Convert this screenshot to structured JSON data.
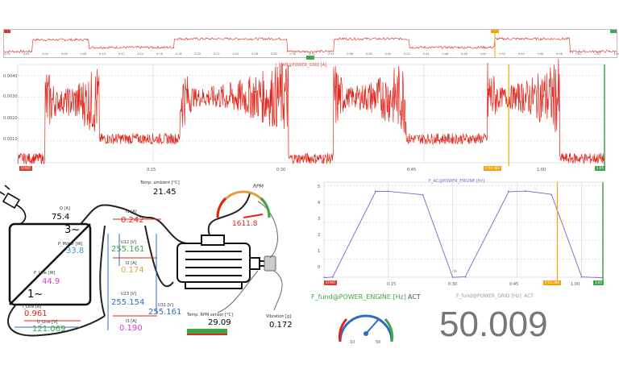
{
  "colors": {
    "signal": "#e0251b",
    "cursor": "#f5a20a",
    "grid": "#c8c8c8",
    "purple": "#8a5cc7",
    "start_badge": "#d83a2b",
    "end_badge": "#3fa548"
  },
  "overview": {
    "ticks": [
      "0:00",
      "0:02",
      "0:04",
      "0:06",
      "0:08",
      "0:10",
      "0:12",
      "0:14",
      "0:16",
      "0:18",
      "0:20",
      "0:22",
      "0:24",
      "0:26",
      "0:28",
      "0:30",
      "0:32",
      "0:34",
      "0:36",
      "0:38",
      "0:40",
      "0:42",
      "0:44",
      "0:46",
      "0:48",
      "0:50",
      "0:52",
      "0:54",
      "0:56",
      "0:58",
      "1:00",
      "1:02",
      "1:04"
    ]
  },
  "current_chart": {
    "title": "I_MAN@POWER_GRID [A]",
    "y_ticks": [
      "0.0040",
      "0.0030",
      "0.0020",
      "0.0010"
    ],
    "x_ticks": [
      "0:15",
      "0:30",
      "0:45",
      "1:00"
    ],
    "start_label": "START",
    "cursor_label": "0:54.389",
    "end_label": "1:05",
    "chart_data": {
      "type": "line",
      "title": "I_MAN@POWER_GRID [A]",
      "x_unit": "s",
      "segments": [
        {
          "from": 0,
          "to": 3,
          "level": 0.0002
        },
        {
          "from": 3,
          "to": 9,
          "level": 0.0028
        },
        {
          "from": 9,
          "to": 18,
          "level": 0.0011
        },
        {
          "from": 18,
          "to": 30,
          "level": 0.003
        },
        {
          "from": 30,
          "to": 35,
          "level": 0.0002
        },
        {
          "from": 35,
          "to": 43,
          "level": 0.003
        },
        {
          "from": 43,
          "to": 52,
          "level": 0.0011
        },
        {
          "from": 52,
          "to": 60,
          "level": 0.003
        },
        {
          "from": 60,
          "to": 65,
          "level": 0.0002
        }
      ]
    }
  },
  "motor": {
    "temp_label": "Temp. ambient [°C]",
    "temp_value": "21.45",
    "rpm_label": "RPM",
    "rpm_value": "1611.8",
    "q_label": "Q [A]",
    "q_value": "75.4",
    "three_phase": "3~",
    "one_phase": "1~",
    "p_motor_label": "P_Motor [W]",
    "p_motor_value": "33.8",
    "p_line_label": "P_Line [W]",
    "p_line_value": "44.9",
    "i_line_label": "I_Line [A]",
    "i_line_value": "0.961",
    "u_line_label": "U_Line [V]",
    "u_line_value": "121.069",
    "i1_label": "I1 [A]",
    "i1_value": "0.242",
    "u12_label": "U12 [V]",
    "u12_value": "255.161",
    "i2_label": "I2 [A]",
    "i2_value": "0.174",
    "u23_label": "U23 [V]",
    "u23_value": "255.154",
    "u31_label": "U31 [V]",
    "u31_value": "255.161",
    "i3_label": "I3 [A]",
    "i3_value": "0.190",
    "temp_rpm_label": "Temp. RPM sensor [°C]",
    "temp_rpm_value": "29.09",
    "vibration_label": "Vibration [g]",
    "vibration_value": "0.172"
  },
  "freq_chart": {
    "title": "F_AC@POWER_ENGINE [Hz]",
    "y_ticks": [
      "5",
      "4",
      "3",
      "2",
      "1",
      "0"
    ],
    "x_ticks": [
      "0:15",
      "0:30",
      "0:45",
      "1:00"
    ],
    "start_label": "START",
    "cursor_label": "0:54.389",
    "end_label": "1:05",
    "chart_data": {
      "type": "line",
      "title": "F_AC@POWER_ENGINE [Hz]",
      "x": [
        0,
        2,
        12,
        15,
        23,
        30,
        33,
        43,
        47,
        53,
        60,
        65
      ],
      "y": [
        0,
        0,
        4.7,
        4.7,
        4.5,
        0,
        0,
        4.7,
        4.7,
        4.5,
        0,
        0
      ]
    }
  },
  "footer": {
    "f_fund_label": "F_fund@POWER_ENGINE [Hz]",
    "f_fund_act": "ACT",
    "f_grid_label": "F_fund@POWER_GRID [Hz]",
    "f_grid_act": "ACT",
    "big_value": "50.009",
    "gauge_min": "0",
    "gauge_max": "0",
    "gauge_low": "10",
    "gauge_high": "50"
  }
}
